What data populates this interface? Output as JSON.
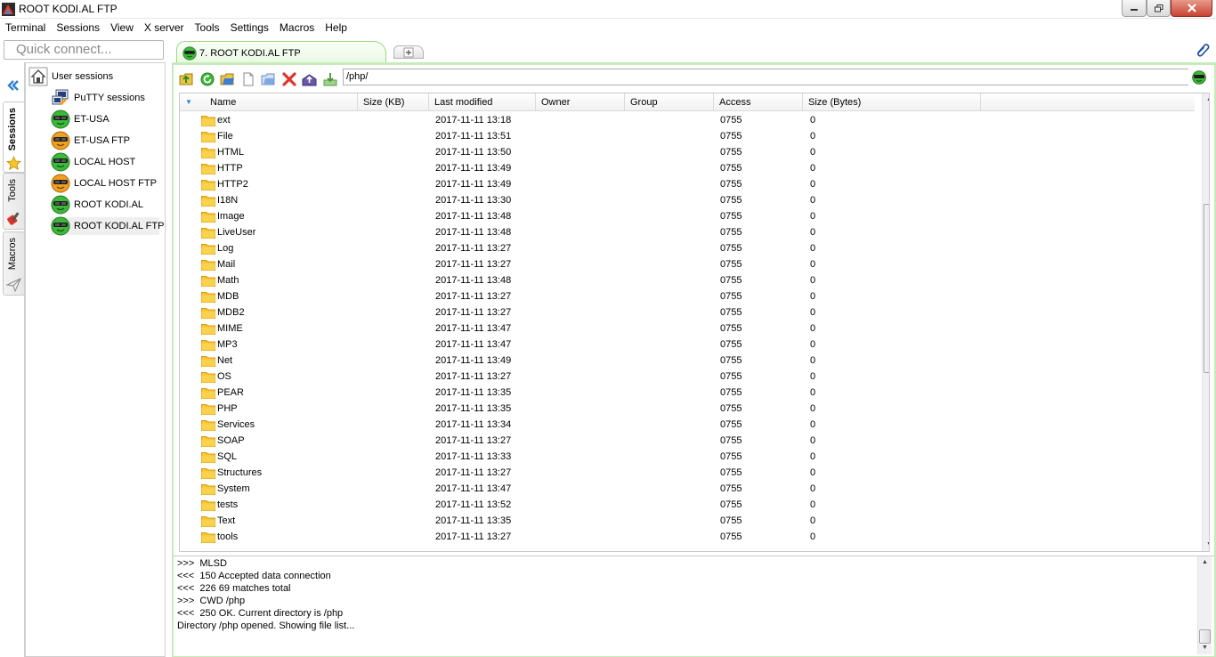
{
  "window": {
    "title": "ROOT KODI.AL FTP",
    "app_icon": "mobaxterm-icon",
    "controls": [
      "minimize-icon",
      "maximize-icon",
      "close-icon"
    ]
  },
  "menu": [
    "Terminal",
    "Sessions",
    "View",
    "X server",
    "Tools",
    "Settings",
    "Macros",
    "Help"
  ],
  "quick_connect": {
    "placeholder": "Quick connect..."
  },
  "side_tabs": [
    {
      "label": "Sessions",
      "icon": "star-icon"
    },
    {
      "label": "Tools",
      "icon": "tools-icon"
    },
    {
      "label": "Macros",
      "icon": "paper-plane-icon"
    }
  ],
  "session_tree": {
    "root": "User sessions",
    "items": [
      {
        "label": "PuTTY sessions",
        "icon": "putty-icon"
      },
      {
        "label": "ET-USA",
        "icon": "ssh-session-icon"
      },
      {
        "label": "ET-USA FTP",
        "icon": "ftp-session-icon"
      },
      {
        "label": "LOCAL HOST",
        "icon": "ssh-session-icon"
      },
      {
        "label": "LOCAL HOST FTP",
        "icon": "ftp-session-icon"
      },
      {
        "label": "ROOT KODI.AL",
        "icon": "ssh-session-icon"
      },
      {
        "label": "ROOT KODI.AL FTP",
        "icon": "ssh-session-icon",
        "selected": true
      }
    ]
  },
  "tabs": {
    "active": "7. ROOT KODI.AL FTP"
  },
  "toolbar": {
    "buttons": [
      "parent-folder-icon",
      "refresh-icon",
      "open-folder-icon",
      "new-file-icon",
      "new-folder-icon",
      "delete-icon",
      "upload-icon",
      "download-icon"
    ],
    "path": "/php/"
  },
  "columns": [
    "Name",
    "Size (KB)",
    "Last modified",
    "Owner",
    "Group",
    "Access",
    "Size (Bytes)"
  ],
  "files": [
    {
      "name": "ext",
      "modified": "2017-11-11 13:18",
      "access": "0755",
      "bytes": "0"
    },
    {
      "name": "File",
      "modified": "2017-11-11 13:51",
      "access": "0755",
      "bytes": "0"
    },
    {
      "name": "HTML",
      "modified": "2017-11-11 13:50",
      "access": "0755",
      "bytes": "0"
    },
    {
      "name": "HTTP",
      "modified": "2017-11-11 13:49",
      "access": "0755",
      "bytes": "0"
    },
    {
      "name": "HTTP2",
      "modified": "2017-11-11 13:49",
      "access": "0755",
      "bytes": "0"
    },
    {
      "name": "I18N",
      "modified": "2017-11-11 13:30",
      "access": "0755",
      "bytes": "0"
    },
    {
      "name": "Image",
      "modified": "2017-11-11 13:48",
      "access": "0755",
      "bytes": "0"
    },
    {
      "name": "LiveUser",
      "modified": "2017-11-11 13:48",
      "access": "0755",
      "bytes": "0"
    },
    {
      "name": "Log",
      "modified": "2017-11-11 13:27",
      "access": "0755",
      "bytes": "0"
    },
    {
      "name": "Mail",
      "modified": "2017-11-11 13:27",
      "access": "0755",
      "bytes": "0"
    },
    {
      "name": "Math",
      "modified": "2017-11-11 13:48",
      "access": "0755",
      "bytes": "0"
    },
    {
      "name": "MDB",
      "modified": "2017-11-11 13:27",
      "access": "0755",
      "bytes": "0"
    },
    {
      "name": "MDB2",
      "modified": "2017-11-11 13:27",
      "access": "0755",
      "bytes": "0"
    },
    {
      "name": "MIME",
      "modified": "2017-11-11 13:47",
      "access": "0755",
      "bytes": "0"
    },
    {
      "name": "MP3",
      "modified": "2017-11-11 13:47",
      "access": "0755",
      "bytes": "0"
    },
    {
      "name": "Net",
      "modified": "2017-11-11 13:49",
      "access": "0755",
      "bytes": "0"
    },
    {
      "name": "OS",
      "modified": "2017-11-11 13:27",
      "access": "0755",
      "bytes": "0"
    },
    {
      "name": "PEAR",
      "modified": "2017-11-11 13:35",
      "access": "0755",
      "bytes": "0"
    },
    {
      "name": "PHP",
      "modified": "2017-11-11 13:35",
      "access": "0755",
      "bytes": "0"
    },
    {
      "name": "Services",
      "modified": "2017-11-11 13:34",
      "access": "0755",
      "bytes": "0"
    },
    {
      "name": "SOAP",
      "modified": "2017-11-11 13:27",
      "access": "0755",
      "bytes": "0"
    },
    {
      "name": "SQL",
      "modified": "2017-11-11 13:33",
      "access": "0755",
      "bytes": "0"
    },
    {
      "name": "Structures",
      "modified": "2017-11-11 13:27",
      "access": "0755",
      "bytes": "0"
    },
    {
      "name": "System",
      "modified": "2017-11-11 13:47",
      "access": "0755",
      "bytes": "0"
    },
    {
      "name": "tests",
      "modified": "2017-11-11 13:52",
      "access": "0755",
      "bytes": "0"
    },
    {
      "name": "Text",
      "modified": "2017-11-11 13:35",
      "access": "0755",
      "bytes": "0"
    },
    {
      "name": "tools",
      "modified": "2017-11-11 13:27",
      "access": "0755",
      "bytes": "0"
    }
  ],
  "log": [
    ">>>  MLSD",
    "<<<  150 Accepted data connection",
    "<<<  226 69 matches total",
    ">>>  CWD /php",
    "<<<  250 OK. Current directory is /php",
    "Directory /php opened. Showing file list..."
  ],
  "colors": {
    "accent_green": "#c5ecb8",
    "folder_yellow": "#f7c331",
    "session_green": "#3db83a",
    "ftp_orange": "#f0a020",
    "sort_arrow_blue": "#2f86d4"
  }
}
